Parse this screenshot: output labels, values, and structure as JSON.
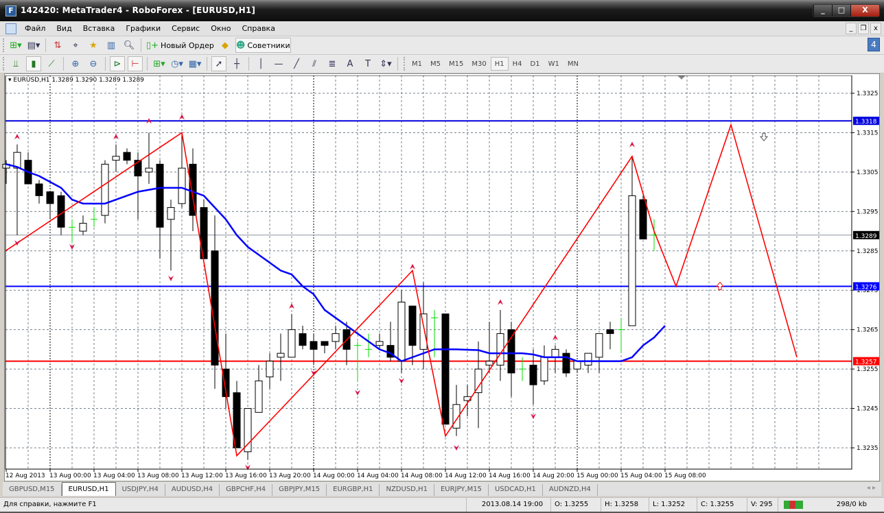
{
  "window": {
    "title": "142420: MetaTrader4 - RoboForex - [EURUSD,H1]",
    "minimize": "_",
    "maximize": "□",
    "close": "X"
  },
  "menu": [
    "Файл",
    "Вид",
    "Вставка",
    "Графики",
    "Сервис",
    "Окно",
    "Справка"
  ],
  "mdi": {
    "min": "_",
    "restore": "❐",
    "close": "x"
  },
  "toolbar1": {
    "new_order": "Новый Ордер",
    "experts": "Советники"
  },
  "notifications_count": "4",
  "timeframes": [
    "M1",
    "M5",
    "M15",
    "M30",
    "H1",
    "H4",
    "D1",
    "W1",
    "MN"
  ],
  "active_timeframe": "H1",
  "chart_info": "EURUSD,H1  1.3289 1.3290 1.3289 1.3289",
  "colors": {
    "bull": "#ffffff",
    "bear": "#000000",
    "ma": "#0000ff",
    "zigzag": "#ff0000",
    "doji": "#00dd00",
    "fractal": "#dd1144",
    "level_blue": "#0000dd",
    "level_red": "#ff0000"
  },
  "tabs": [
    "GBPUSD,M15",
    "EURUSD,H1",
    "USDJPY,H4",
    "AUDUSD,H4",
    "GBPCHF,H4",
    "GBPJPY,M15",
    "EURGBP,H1",
    "NZDUSD,H1",
    "EURJPY,M15",
    "USDCAD,H1",
    "AUDNZD,H4"
  ],
  "active_tab": "EURUSD,H1",
  "status": {
    "help": "Для справки, нажмите F1",
    "datetime": "2013.08.14 19:00",
    "open": "O: 1.3255",
    "high": "H: 1.3258",
    "low": "L: 1.3252",
    "close": "C: 1.3255",
    "volume": "V: 295",
    "traffic": "298/0 kb"
  },
  "chart_data": {
    "type": "candlestick",
    "symbol": "EURUSD",
    "timeframe": "H1",
    "ylim": [
      1.3229,
      1.3334
    ],
    "y_ticks": [
      "1.3325",
      "1.3315",
      "1.3305",
      "1.3295",
      "1.3285",
      "1.3275",
      "1.3265",
      "1.3255",
      "1.3245",
      "1.3235"
    ],
    "x_labels": [
      "12 Aug 2013",
      "13 Aug 00:00",
      "13 Aug 04:00",
      "13 Aug 08:00",
      "13 Aug 12:00",
      "13 Aug 16:00",
      "13 Aug 20:00",
      "14 Aug 00:00",
      "14 Aug 04:00",
      "14 Aug 08:00",
      "14 Aug 12:00",
      "14 Aug 16:00",
      "14 Aug 20:00",
      "15 Aug 00:00",
      "15 Aug 04:00",
      "15 Aug 08:00"
    ],
    "ohlc": [
      [
        1.3306,
        1.3308,
        1.3302,
        1.3307
      ],
      [
        1.3306,
        1.3312,
        1.3289,
        1.331
      ],
      [
        1.3308,
        1.331,
        1.3302,
        1.3302
      ],
      [
        1.3302,
        1.3303,
        1.3297,
        1.3299
      ],
      [
        1.33,
        1.33,
        1.3293,
        1.3297
      ],
      [
        1.3299,
        1.33,
        1.3289,
        1.3291
      ],
      [
        1.3291,
        1.3293,
        1.3287,
        1.3291
      ],
      [
        1.329,
        1.3294,
        1.3289,
        1.3292
      ],
      [
        1.3293,
        1.3296,
        1.3291,
        1.3293
      ],
      [
        1.3294,
        1.3308,
        1.3292,
        1.3307
      ],
      [
        1.3308,
        1.3312,
        1.3305,
        1.3309
      ],
      [
        1.331,
        1.3311,
        1.3307,
        1.3308
      ],
      [
        1.3308,
        1.331,
        1.3293,
        1.3304
      ],
      [
        1.3305,
        1.3315,
        1.3302,
        1.3306
      ],
      [
        1.3307,
        1.3308,
        1.3283,
        1.3291
      ],
      [
        1.3293,
        1.3298,
        1.328,
        1.3296
      ],
      [
        1.3297,
        1.3315,
        1.3296,
        1.3306
      ],
      [
        1.3307,
        1.3311,
        1.329,
        1.3294
      ],
      [
        1.3296,
        1.3298,
        1.3283,
        1.3283
      ],
      [
        1.3285,
        1.3294,
        1.325,
        1.3256
      ],
      [
        1.3255,
        1.3264,
        1.3245,
        1.3248
      ],
      [
        1.3249,
        1.3252,
        1.3235,
        1.3235
      ],
      [
        1.3234,
        1.3245,
        1.3232,
        1.3245
      ],
      [
        1.3244,
        1.3256,
        1.3244,
        1.3252
      ],
      [
        1.3253,
        1.3259,
        1.325,
        1.3257
      ],
      [
        1.3258,
        1.3264,
        1.3252,
        1.3259
      ],
      [
        1.3258,
        1.3269,
        1.3258,
        1.3265
      ],
      [
        1.3264,
        1.3266,
        1.326,
        1.3261
      ],
      [
        1.3262,
        1.3264,
        1.3256,
        1.326
      ],
      [
        1.3262,
        1.3262,
        1.3259,
        1.3261
      ],
      [
        1.3262,
        1.3266,
        1.326,
        1.3264
      ],
      [
        1.3265,
        1.3267,
        1.3256,
        1.326
      ],
      [
        1.3261,
        1.3262,
        1.3252,
        1.3261
      ],
      [
        1.326,
        1.3264,
        1.3258,
        1.326
      ],
      [
        1.3261,
        1.3264,
        1.326,
        1.3262
      ],
      [
        1.3261,
        1.3267,
        1.3257,
        1.3258
      ],
      [
        1.3257,
        1.3275,
        1.3254,
        1.3272
      ],
      [
        1.3271,
        1.3271,
        1.3256,
        1.3261
      ],
      [
        1.326,
        1.3277,
        1.3255,
        1.3269
      ],
      [
        1.3268,
        1.327,
        1.3258,
        1.3268
      ],
      [
        1.3269,
        1.3269,
        1.3241,
        1.3241
      ],
      [
        1.324,
        1.3251,
        1.3238,
        1.3246
      ],
      [
        1.3247,
        1.3251,
        1.3243,
        1.3248
      ],
      [
        1.3249,
        1.3262,
        1.324,
        1.3255
      ],
      [
        1.3256,
        1.3267,
        1.3254,
        1.3257
      ],
      [
        1.3256,
        1.327,
        1.3252,
        1.3264
      ],
      [
        1.3265,
        1.3267,
        1.3248,
        1.3254
      ],
      [
        1.3255,
        1.3258,
        1.3252,
        1.3255
      ],
      [
        1.3256,
        1.326,
        1.3246,
        1.3251
      ],
      [
        1.3252,
        1.3261,
        1.3251,
        1.3258
      ],
      [
        1.3258,
        1.3261,
        1.3254,
        1.326
      ],
      [
        1.3259,
        1.326,
        1.3253,
        1.3254
      ],
      [
        1.3255,
        1.3257,
        1.3254,
        1.3257
      ],
      [
        1.3256,
        1.3259,
        1.3254,
        1.3259
      ],
      [
        1.3258,
        1.3264,
        1.3254,
        1.3264
      ],
      [
        1.3265,
        1.3267,
        1.326,
        1.3264
      ],
      [
        1.3265,
        1.3268,
        1.3259,
        1.3265
      ],
      [
        1.3266,
        1.3309,
        1.3266,
        1.3299
      ],
      [
        1.3298,
        1.3299,
        1.3288,
        1.3288
      ],
      [
        1.3289,
        1.3293,
        1.3285,
        1.3289
      ]
    ],
    "ma": [
      1.3307,
      1.33063,
      1.3305,
      1.3304,
      1.33025,
      1.3301,
      1.3298,
      1.3297,
      1.3297,
      1.3297,
      1.3298,
      1.3299,
      1.33,
      1.33005,
      1.3301,
      1.3301,
      1.3301,
      1.33,
      1.3299,
      1.3296,
      1.3293,
      1.3289,
      1.3286,
      1.3284,
      1.3282,
      1.328,
      1.3279,
      1.3276,
      1.3274,
      1.327,
      1.3268,
      1.3266,
      1.3264,
      1.3262,
      1.326,
      1.3259,
      1.3257,
      1.3258,
      1.3259,
      1.326,
      1.326,
      1.326,
      1.32599,
      1.32598,
      1.3259,
      1.3259,
      1.3259,
      1.3259,
      1.32587,
      1.3258,
      1.3258,
      1.3258,
      1.3257,
      1.3257,
      1.3257,
      1.3257,
      1.3257,
      1.3258,
      1.3261,
      1.3263,
      1.3266
    ],
    "zigzag": [
      [
        -0.06,
        1.3285
      ],
      [
        16,
        1.3315
      ],
      [
        21,
        1.3233
      ],
      [
        37,
        1.328
      ],
      [
        40,
        1.3238
      ],
      [
        57,
        1.3309
      ],
      [
        59,
        1.329
      ],
      [
        61,
        1.3276
      ],
      [
        66,
        1.3317
      ],
      [
        72,
        1.3258
      ]
    ],
    "fractals_up": [
      [
        1,
        1.3314
      ],
      [
        10,
        1.3314
      ],
      [
        13,
        1.3318
      ],
      [
        16,
        1.3319
      ],
      [
        26,
        1.3271
      ],
      [
        37,
        1.3281
      ],
      [
        45,
        1.3272
      ],
      [
        50,
        1.3263
      ],
      [
        57,
        1.3312
      ]
    ],
    "fractals_down": [
      [
        1,
        1.3287
      ],
      [
        6,
        1.3286
      ],
      [
        15,
        1.3278
      ],
      [
        22,
        1.323
      ],
      [
        28,
        1.3254
      ],
      [
        32,
        1.3249
      ],
      [
        36,
        1.3252
      ],
      [
        41,
        1.3235
      ],
      [
        48,
        1.3243
      ]
    ],
    "arrow_up": [
      65,
      1.3276
    ],
    "arrow_down": [
      69,
      1.3314
    ],
    "levels": [
      {
        "price": 1.3318,
        "label": "1.3318",
        "color": "#0000dd"
      },
      {
        "price": 1.3276,
        "label": "1.3276",
        "color": "#0000ff"
      },
      {
        "price": 1.3257,
        "label": "1.3257",
        "color": "#ff0000"
      },
      {
        "price": 1.3289,
        "label": "1.3289",
        "color": "#000000"
      }
    ]
  }
}
